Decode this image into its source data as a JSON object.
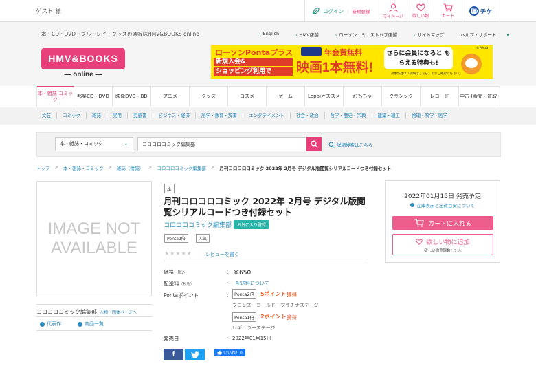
{
  "topbar": {
    "guest": "ゲスト 様",
    "login": "ログイン",
    "register": "新規登録",
    "mypage": "マイページ",
    "wishlist": "欲しい物",
    "cart": "カート",
    "ocheke": "チケ"
  },
  "header": {
    "tagline": "本・CD・DVD・ブルーレイ・グッズの通販はHMV&BOOKS online",
    "links": [
      "English",
      "HMV店舗",
      "ローソン・ミニストップ店舗",
      "サイトマップ",
      "ヘルプ・サポート"
    ],
    "logo_top": "HMV&BOOKS",
    "logo_bottom": "— online —",
    "banner": {
      "line1": "ローソンPontaプラス",
      "line1b": "年会費無料",
      "line2": "新規入会&",
      "line3": "ショッピング利用で",
      "big": "映画1本無料!",
      "right": "さらに会員になると もらえる特典も!",
      "note": "対象作品は「詳細はこちら」よりご確認ください。",
      "tag": "©Ponta"
    }
  },
  "nav": {
    "tabs": [
      "本・雑誌 コミック",
      "邦楽CD・DVD",
      "映像DVD・BD",
      "アニメ",
      "グッズ",
      "コスメ",
      "ゲーム",
      "Loppiオススメ",
      "おもちゃ",
      "クラシック",
      "レコード",
      "中古 (販売・買取)"
    ],
    "subitems": [
      "文芸",
      "コミック",
      "雑誌",
      "実用",
      "児童書",
      "ビジネス・経済",
      "語学・教育・辞書",
      "エンタテイメント",
      "社会・政治",
      "哲学・歴史・宗教",
      "建築・理工",
      "物理・科学・医学"
    ]
  },
  "search": {
    "category": "本・雑誌・コミック",
    "query": "コロコロコミック編集部",
    "advanced": "詳細検索はこちら"
  },
  "breadcrumb": {
    "items": [
      "トップ",
      "本・雑誌・コミック",
      "雑誌（情報）",
      "コロコロコミック編集部"
    ],
    "current": "月刊コロコロコミック 2022年 2月号 デジタル版閲覧シリアルコードつき付録セット"
  },
  "product": {
    "noimage_l1": "IMAGE NOT",
    "noimage_l2": "AVAILABLE",
    "artist": "コロコロコミック編集部",
    "artist_sub": "人物・団体ページへ",
    "link_works": "代表作",
    "link_items": "商品一覧",
    "type_badge": "本",
    "title": "月刊コロコロコミック 2022年 2月号 デジタル版閲覧シリアルコードつき付録セット",
    "publisher": "コロコロコミック編集部",
    "fav": "お気に入り登録",
    "tags": [
      "Ponta2倍",
      "人気"
    ],
    "stars": "★★★★★",
    "review_link": "レビューを書く",
    "price_label": "価格",
    "price_tax": "（税込）",
    "price": "￥650",
    "ship_label": "配送料",
    "ship_tax": "（税込）",
    "ship_link": "配送料について",
    "ponta_label": "Pontaポイント",
    "ponta": [
      {
        "badge": "Ponta2倍",
        "points": "5ポイント",
        "suffix": "獲得",
        "stage": "ブロンズ・ゴールド・プラチナステージ"
      },
      {
        "badge": "Ponta1倍",
        "points": "2ポイント",
        "suffix": "獲得",
        "stage": "レギュラーステージ"
      }
    ],
    "release_label": "発売日",
    "release_value": "2022年01月15日",
    "colon": "：",
    "fb": "f",
    "like": "いいね！0"
  },
  "side": {
    "release": "2022年01月15日 発売予定",
    "stock_link": "在庫表示と出荷目安について",
    "cart_button": "カートに入れる",
    "wish_button": "欲しい物に追加",
    "wish_count": "欲しい物登録数：5 人"
  },
  "colors": {
    "accent": "#e8407a",
    "link": "#2a8bbf",
    "teal": "#2a9d8f",
    "points": "#e8602c"
  }
}
